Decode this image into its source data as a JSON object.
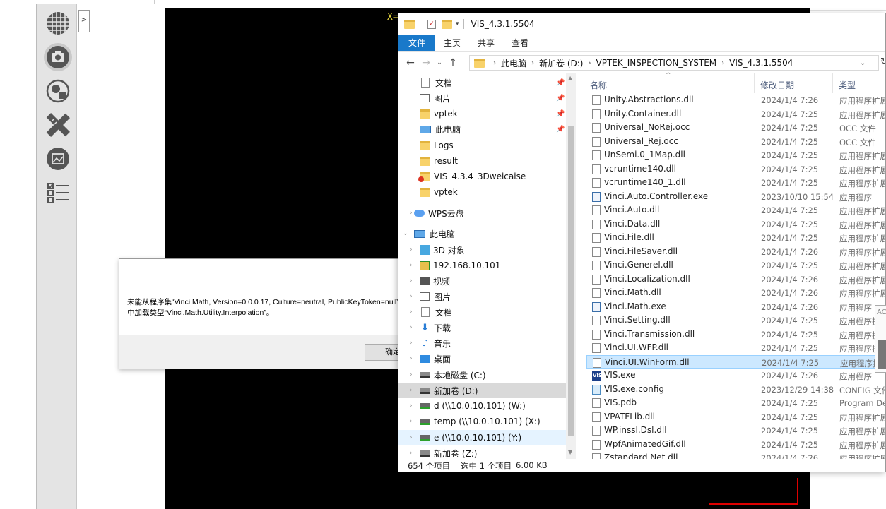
{
  "viewer": {
    "coord_label": "X="
  },
  "toolbar": {
    "tools": [
      {
        "name": "grid-tool"
      },
      {
        "name": "camera-tool"
      },
      {
        "name": "map-tool"
      },
      {
        "name": "measure-tool"
      },
      {
        "name": "image-tool"
      },
      {
        "name": "checklist-tool"
      }
    ],
    "expand_label": ">"
  },
  "error_dialog": {
    "message_line1": "未能从程序集“Vinci.Math, Version=0.0.0.17, Culture=neutral, PublicKeyToken=null”",
    "message_line2": "中加载类型“Vinci.Math.Utility.Interpolation”。",
    "ok_label": "确定"
  },
  "explorer": {
    "title": "VIS_4.3.1.5504",
    "ribbon_tabs": [
      "文件",
      "主页",
      "共享",
      "查看"
    ],
    "path": [
      "此电脑",
      "新加卷 (D:)",
      "VPTEK_INSPECTION_SYSTEM",
      "VIS_4.3.1.5504"
    ],
    "nav_items": [
      {
        "label": "文档",
        "icon": "document-icon",
        "pinned": true
      },
      {
        "label": "图片",
        "icon": "picture-icon",
        "pinned": true
      },
      {
        "label": "vptek",
        "icon": "folder-icon",
        "pinned": true
      },
      {
        "label": "此电脑",
        "icon": "pc-icon",
        "pinned": true
      },
      {
        "label": "Logs",
        "icon": "folder-icon"
      },
      {
        "label": "result",
        "icon": "folder-icon"
      },
      {
        "label": "VIS_4.3.4_3Dweicaise",
        "icon": "folder-error-icon"
      },
      {
        "label": "vptek",
        "icon": "folder-icon"
      },
      {
        "label": "WPS云盘",
        "icon": "cloud-icon"
      },
      {
        "label": "此电脑",
        "icon": "pc-icon"
      },
      {
        "label": "3D 对象",
        "icon": "3d-objects-icon"
      },
      {
        "label": "192.168.10.101",
        "icon": "network-folder-icon"
      },
      {
        "label": "视频",
        "icon": "video-icon"
      },
      {
        "label": "图片",
        "icon": "picture-icon"
      },
      {
        "label": "文档",
        "icon": "document-icon"
      },
      {
        "label": "下载",
        "icon": "download-icon"
      },
      {
        "label": "音乐",
        "icon": "music-icon"
      },
      {
        "label": "桌面",
        "icon": "desktop-icon"
      },
      {
        "label": "本地磁盘 (C:)",
        "icon": "drive-icon"
      },
      {
        "label": "新加卷 (D:)",
        "icon": "drive-icon",
        "selected": true
      },
      {
        "label": "d (\\\\10.0.10.101) (W:)",
        "icon": "network-drive-icon"
      },
      {
        "label": "temp (\\\\10.0.10.101) (X:)",
        "icon": "network-drive-icon"
      },
      {
        "label": "e (\\\\10.0.10.101) (Y:)",
        "icon": "network-drive-icon",
        "hover": true
      },
      {
        "label": "新加卷 (Z:)",
        "icon": "drive-icon"
      }
    ],
    "columns": {
      "name": "名称",
      "date": "修改日期",
      "type": "类型"
    },
    "files": [
      {
        "name": "Unity.Abstractions.dll",
        "date": "2024/1/4 7:26",
        "type": "应用程序扩展",
        "icon": "dll-icon"
      },
      {
        "name": "Unity.Container.dll",
        "date": "2024/1/4 7:25",
        "type": "应用程序扩展",
        "icon": "dll-icon"
      },
      {
        "name": "Universal_NoRej.occ",
        "date": "2024/1/4 7:25",
        "type": "OCC 文件",
        "icon": "file-icon"
      },
      {
        "name": "Universal_Rej.occ",
        "date": "2024/1/4 7:25",
        "type": "OCC 文件",
        "icon": "file-icon"
      },
      {
        "name": "UnSemi.0_1Map.dll",
        "date": "2024/1/4 7:25",
        "type": "应用程序扩展",
        "icon": "dll-icon"
      },
      {
        "name": "vcruntime140.dll",
        "date": "2024/1/4 7:25",
        "type": "应用程序扩展",
        "icon": "dll-icon"
      },
      {
        "name": "vcruntime140_1.dll",
        "date": "2024/1/4 7:25",
        "type": "应用程序扩展",
        "icon": "dll-icon"
      },
      {
        "name": "Vinci.Auto.Controller.exe",
        "date": "2023/10/10 15:54",
        "type": "应用程序",
        "icon": "exe-icon"
      },
      {
        "name": "Vinci.Auto.dll",
        "date": "2024/1/4 7:25",
        "type": "应用程序扩展",
        "icon": "dll-icon"
      },
      {
        "name": "Vinci.Data.dll",
        "date": "2024/1/4 7:25",
        "type": "应用程序扩展",
        "icon": "dll-icon"
      },
      {
        "name": "Vinci.File.dll",
        "date": "2024/1/4 7:25",
        "type": "应用程序扩展",
        "icon": "dll-icon"
      },
      {
        "name": "Vinci.FileSaver.dll",
        "date": "2024/1/4 7:26",
        "type": "应用程序扩展",
        "icon": "dll-icon"
      },
      {
        "name": "Vinci.Generel.dll",
        "date": "2024/1/4 7:25",
        "type": "应用程序扩展",
        "icon": "dll-icon"
      },
      {
        "name": "Vinci.Localization.dll",
        "date": "2024/1/4 7:26",
        "type": "应用程序扩展",
        "icon": "dll-icon"
      },
      {
        "name": "Vinci.Math.dll",
        "date": "2024/1/4 7:26",
        "type": "应用程序扩展",
        "icon": "dll-icon"
      },
      {
        "name": "Vinci.Math.exe",
        "date": "2024/1/4 7:26",
        "type": "应用程序",
        "icon": "exe-icon"
      },
      {
        "name": "Vinci.Setting.dll",
        "date": "2024/1/4 7:25",
        "type": "应用程序扩",
        "icon": "dll-icon"
      },
      {
        "name": "Vinci.Transmission.dll",
        "date": "2024/1/4 7:25",
        "type": "应用程序扩",
        "icon": "dll-icon"
      },
      {
        "name": "Vinci.UI.WFP.dll",
        "date": "2024/1/4 7:25",
        "type": "应用程序扩",
        "icon": "dll-icon"
      },
      {
        "name": "Vinci.UI.WinForm.dll",
        "date": "2024/1/4 7:25",
        "type": "应用程序扩",
        "icon": "dll-icon",
        "selected": true
      },
      {
        "name": "VIS.exe",
        "date": "2024/1/4 7:26",
        "type": "应用程序",
        "icon": "vis-app-icon"
      },
      {
        "name": "VIS.exe.config",
        "date": "2023/12/29 14:38",
        "type": "CONFIG 文件",
        "icon": "config-icon"
      },
      {
        "name": "VIS.pdb",
        "date": "2024/1/4 7:25",
        "type": "Program Del",
        "icon": "file-icon"
      },
      {
        "name": "VPATFLib.dll",
        "date": "2024/1/4 7:25",
        "type": "应用程序扩展",
        "icon": "dll-icon"
      },
      {
        "name": "WP.inssl.Dsl.dll",
        "date": "2024/1/4 7:25",
        "type": "应用程序扩展",
        "icon": "dll-icon"
      },
      {
        "name": "WpfAnimatedGif.dll",
        "date": "2024/1/4 7:25",
        "type": "应用程序扩展",
        "icon": "dll-icon"
      },
      {
        "name": "Zstandard.Net.dll",
        "date": "2024/1/4 7:26",
        "type": "应用程序扩展",
        "icon": "dll-icon"
      }
    ],
    "status": {
      "count": "654 个项目",
      "selection": "选中 1 个项目",
      "size": "6.00 KB"
    }
  },
  "peek_window": {
    "text": "AC"
  }
}
